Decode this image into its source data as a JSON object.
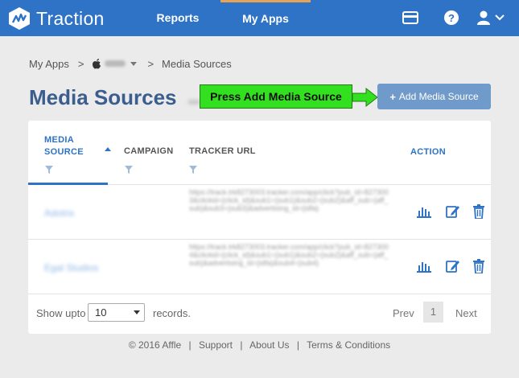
{
  "brand": {
    "name": "Traction"
  },
  "nav": {
    "reports": "Reports",
    "my_apps": "My Apps"
  },
  "breadcrumb": {
    "root": "My Apps",
    "sep": ">",
    "current": "Media Sources"
  },
  "page": {
    "title": "Media Sources"
  },
  "annotation": {
    "callout": "Press Add Media Source"
  },
  "actions": {
    "add_media_source": "Add Media Source"
  },
  "table": {
    "headers": {
      "media_source_line1": "MEDIA",
      "media_source_line2": "SOURCE",
      "campaign": "CAMPAIGN",
      "tracker_url": "TRACKER URL",
      "action": "ACTION"
    },
    "rows": [
      {
        "media_source": "Adotrix",
        "campaign": "",
        "tracker_url": "https://track.trk8273003.tracker.com/app/click?pub_id=8273003&clickid={click_id}&sub1={sub1}&sub2={sub2}&aff_sub={aff_sub}&sub3={sub3}&advertising_id={idfa}"
      },
      {
        "media_source": "Egal Studios",
        "campaign": "",
        "tracker_url": "https://track.trk8273003.tracker.com/app/click?pub_id=8273004&clickid={click_id}&sub1={sub1}&sub2={sub2}&aff_sub={aff_sub}&advertising_id={idfa}&sub4={sub4}"
      }
    ]
  },
  "pagination": {
    "show_upto_label": "Show upto",
    "page_size": "10",
    "records_label": "records.",
    "prev": "Prev",
    "current_page": "1",
    "next": "Next"
  },
  "footer": {
    "copyright": "© 2016 Affle",
    "support": "Support",
    "about": "About Us",
    "terms": "Terms & Conditions",
    "sep": "|"
  },
  "colors": {
    "topbar": "#2e73c5",
    "accent": "#2e73c5",
    "active_tab_indicator": "#e8a253",
    "add_button": "#6f9ac9",
    "callout": "#33e01f",
    "title": "#3c5e8e"
  }
}
